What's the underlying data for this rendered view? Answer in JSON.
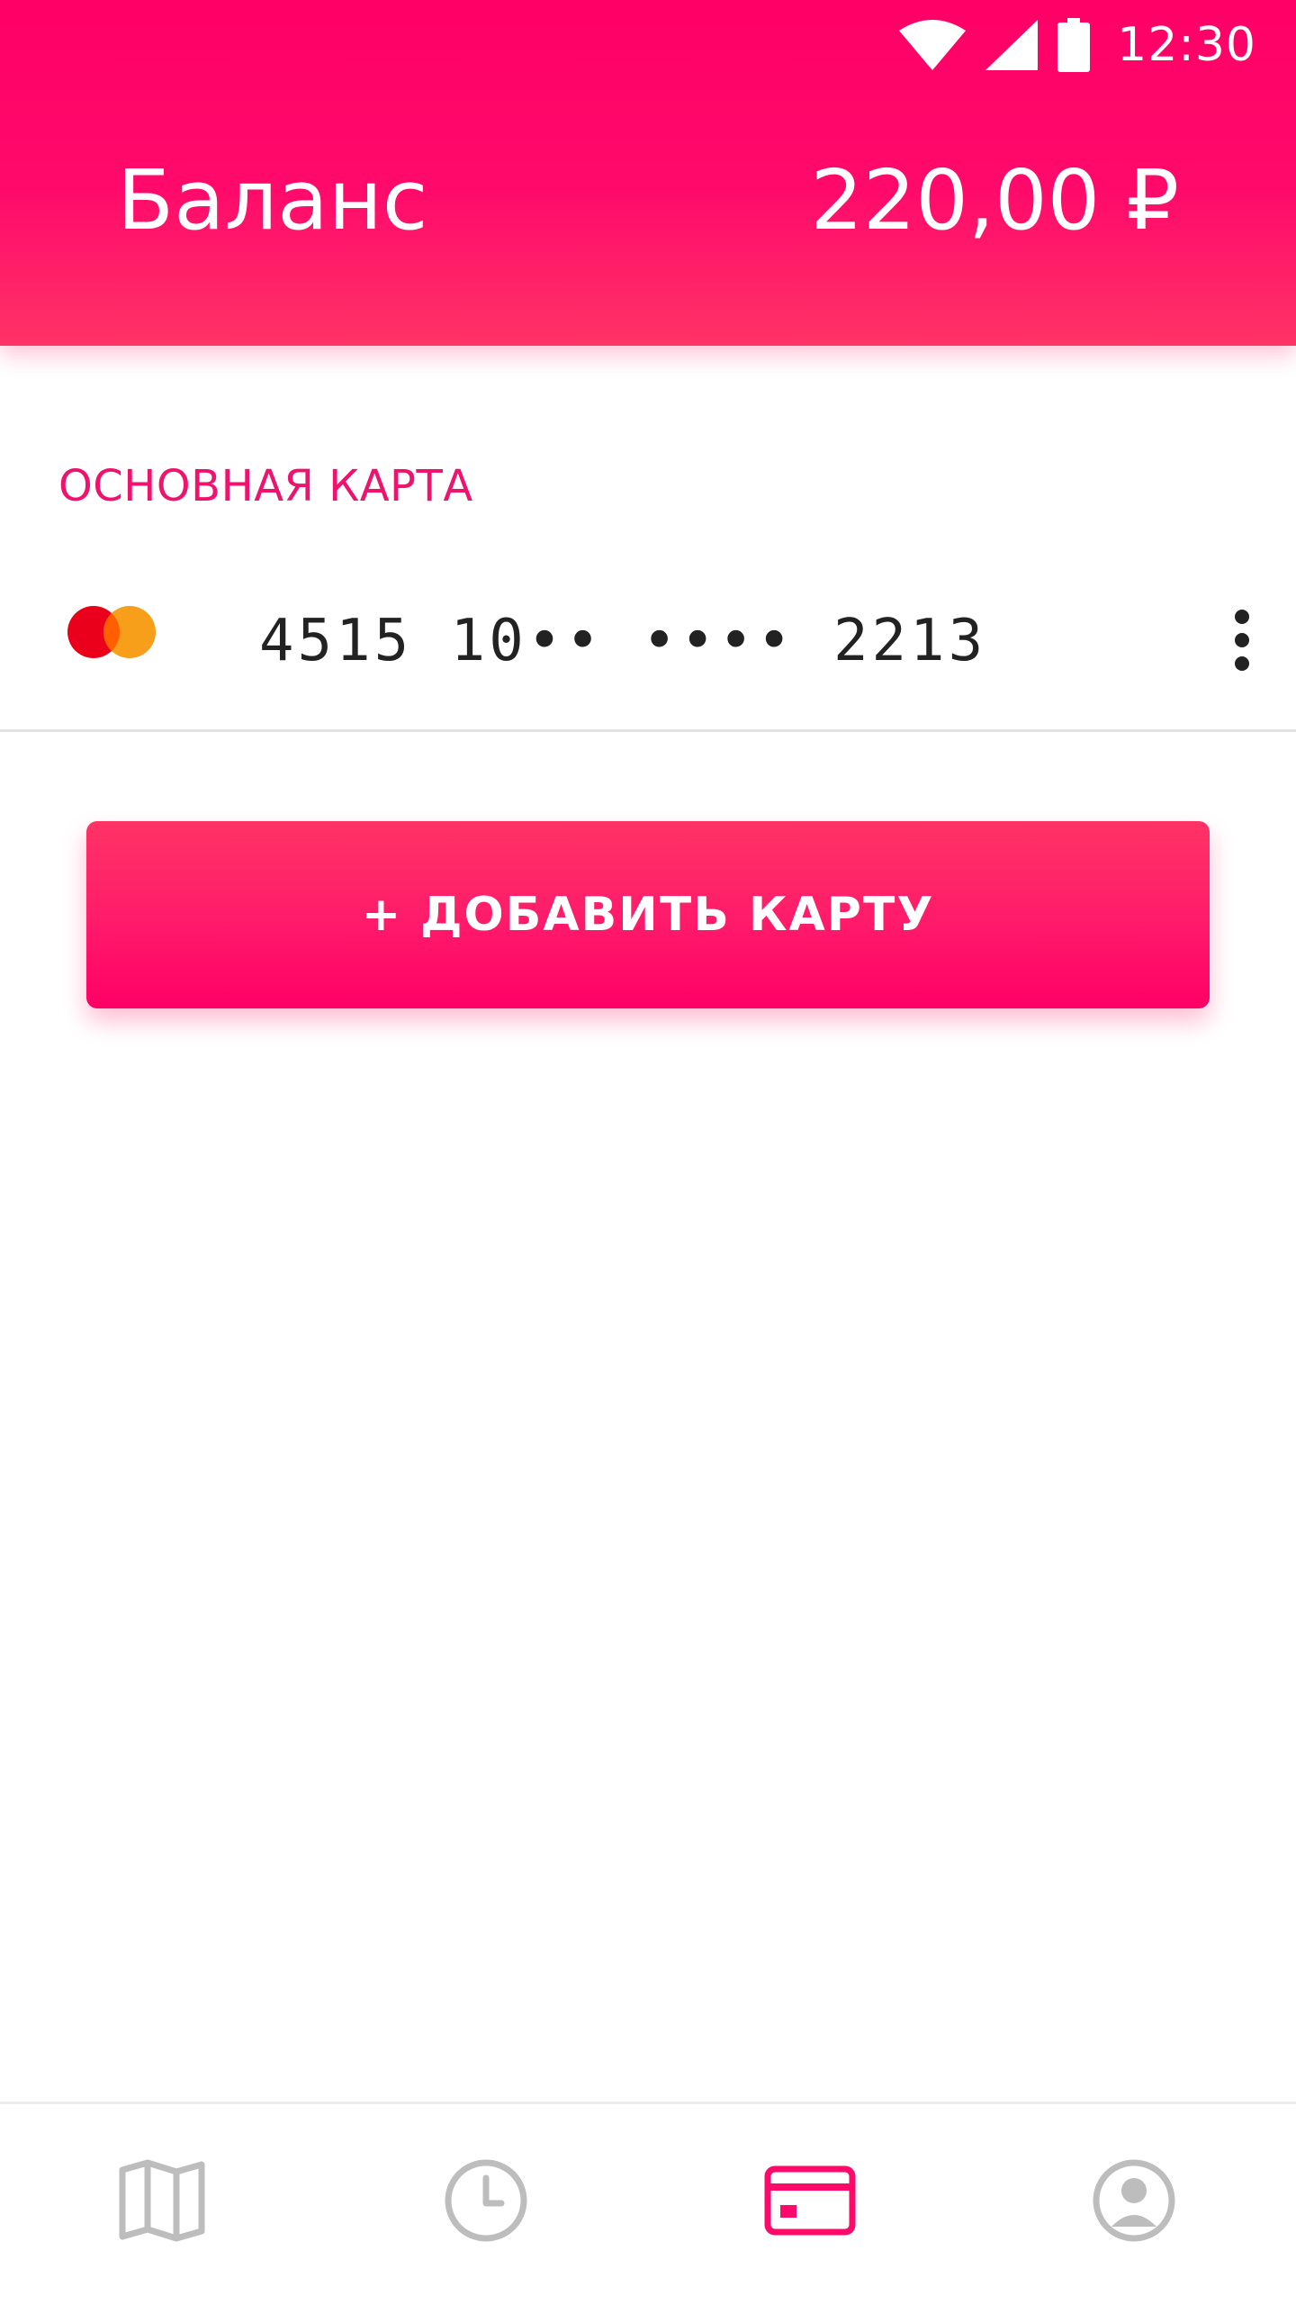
{
  "status_bar": {
    "time": "12:30",
    "icons": [
      "wifi-icon",
      "signal-icon",
      "battery-icon"
    ],
    "color": "#ffffff"
  },
  "header": {
    "title": "Баланс",
    "balance": "220,00 ₽",
    "gradient_colors": [
      "#ff0066",
      "#ff3366"
    ]
  },
  "main_card": {
    "section_title": "ОСНОВНАЯ КАРТА",
    "card_number": "4515 10•• •••• 2213",
    "card_brand_icon": "mastercard-icon",
    "menu_icon": "more-vertical-icon"
  },
  "add_card_button": {
    "label": "+ ДОБАВИТЬ КАРТУ"
  },
  "bottom_nav": {
    "items": [
      {
        "icon": "map-icon",
        "active": false
      },
      {
        "icon": "clock-icon",
        "active": false
      },
      {
        "icon": "card-icon",
        "active": true
      },
      {
        "icon": "profile-icon",
        "active": false
      }
    ],
    "active_color": "#ff0a6b",
    "inactive_color": "#bdbdbd"
  },
  "colors": {
    "accent": "#ff0a6b",
    "section_title": "#f0136d",
    "card_number_text": "#222222",
    "divider": "#e2e2e2"
  }
}
